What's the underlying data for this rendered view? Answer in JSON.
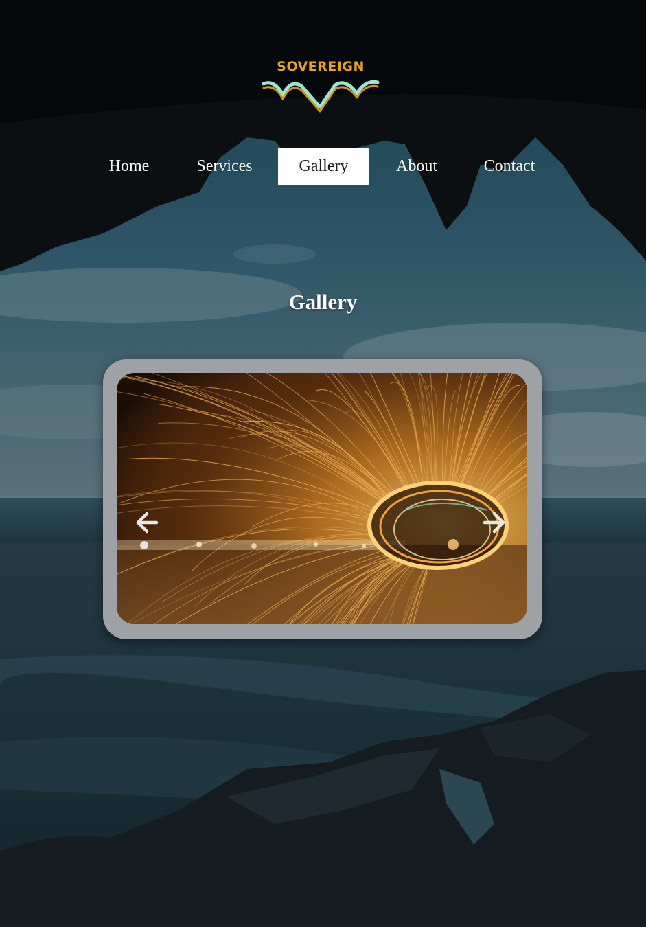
{
  "brand": {
    "name": "SOVEREIGN",
    "color": "#e8a51c",
    "wave_colors": [
      "#e8a51c",
      "#9fe3d3"
    ]
  },
  "nav": {
    "items": [
      {
        "label": "Home",
        "active": false
      },
      {
        "label": "Services",
        "active": false
      },
      {
        "label": "Gallery",
        "active": true
      },
      {
        "label": "About",
        "active": false
      },
      {
        "label": "Contact",
        "active": false
      }
    ]
  },
  "main": {
    "title": "Gallery"
  },
  "carousel": {
    "prev_icon": "arrow-left-icon",
    "next_icon": "arrow-right-icon",
    "slide_subject": "steel wool light painting"
  },
  "colors": {
    "nav_active_bg": "#ffffff",
    "frame": "#9ea2a6",
    "sky": "#1f4a5a",
    "cave": "#0b0f12"
  }
}
